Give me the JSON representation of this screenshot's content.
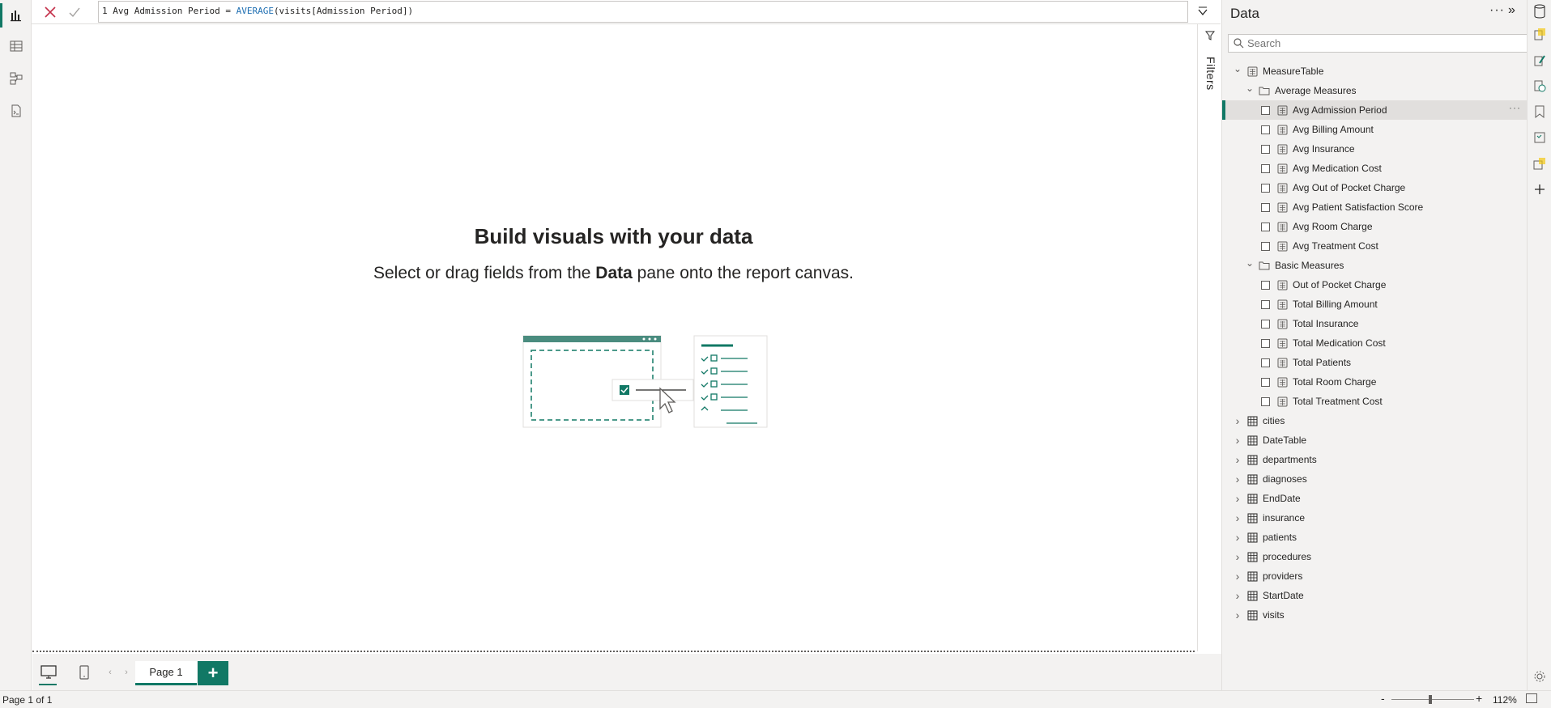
{
  "formula": {
    "line_number": "1",
    "measure_name": "Avg Admission Period = ",
    "function": "AVERAGE",
    "args": "(visits[Admission Period])"
  },
  "canvas": {
    "empty_title": "Build visuals with your data",
    "empty_sub_before": "Select or drag fields from the ",
    "empty_sub_bold": "Data",
    "empty_sub_after": " pane onto the report canvas."
  },
  "filters": {
    "label": "Filters"
  },
  "tabs": {
    "page1": "Page 1",
    "add": "+"
  },
  "status": {
    "page_status": "Page 1 of 1",
    "zoom_level": "112%",
    "zoom_fraction": 0.45
  },
  "data_pane": {
    "title": "Data",
    "search_placeholder": "Search",
    "tree": [
      {
        "label": "MeasureTable",
        "level": 0,
        "type": "measure-table",
        "expanded": true
      },
      {
        "label": "Average Measures",
        "level": 1,
        "type": "folder",
        "expanded": true
      },
      {
        "label": "Avg Admission Period",
        "level": 2,
        "type": "measure",
        "selected": true
      },
      {
        "label": "Avg Billing Amount",
        "level": 2,
        "type": "measure"
      },
      {
        "label": "Avg Insurance",
        "level": 2,
        "type": "measure"
      },
      {
        "label": "Avg Medication Cost",
        "level": 2,
        "type": "measure"
      },
      {
        "label": "Avg Out of Pocket Charge",
        "level": 2,
        "type": "measure"
      },
      {
        "label": "Avg Patient Satisfaction Score",
        "level": 2,
        "type": "measure"
      },
      {
        "label": "Avg Room Charge",
        "level": 2,
        "type": "measure"
      },
      {
        "label": "Avg Treatment Cost",
        "level": 2,
        "type": "measure"
      },
      {
        "label": "Basic Measures",
        "level": 1,
        "type": "folder",
        "expanded": true
      },
      {
        "label": "Out of Pocket Charge",
        "level": 2,
        "type": "measure"
      },
      {
        "label": "Total Billing Amount",
        "level": 2,
        "type": "measure"
      },
      {
        "label": "Total Insurance",
        "level": 2,
        "type": "measure"
      },
      {
        "label": "Total Medication Cost",
        "level": 2,
        "type": "measure"
      },
      {
        "label": "Total Patients",
        "level": 2,
        "type": "measure"
      },
      {
        "label": "Total Room Charge",
        "level": 2,
        "type": "measure"
      },
      {
        "label": "Total Treatment Cost",
        "level": 2,
        "type": "measure"
      },
      {
        "label": "cities",
        "level": 0,
        "type": "table"
      },
      {
        "label": "DateTable",
        "level": 0,
        "type": "table"
      },
      {
        "label": "departments",
        "level": 0,
        "type": "table"
      },
      {
        "label": "diagnoses",
        "level": 0,
        "type": "table"
      },
      {
        "label": "EndDate",
        "level": 0,
        "type": "table"
      },
      {
        "label": "insurance",
        "level": 0,
        "type": "table"
      },
      {
        "label": "patients",
        "level": 0,
        "type": "table"
      },
      {
        "label": "procedures",
        "level": 0,
        "type": "table"
      },
      {
        "label": "providers",
        "level": 0,
        "type": "table"
      },
      {
        "label": "StartDate",
        "level": 0,
        "type": "table"
      },
      {
        "label": "visits",
        "level": 0,
        "type": "table"
      }
    ]
  },
  "colors": {
    "accent": "#117865",
    "dax_function": "#1f6fb2",
    "cancel_x": "#c4314b"
  }
}
